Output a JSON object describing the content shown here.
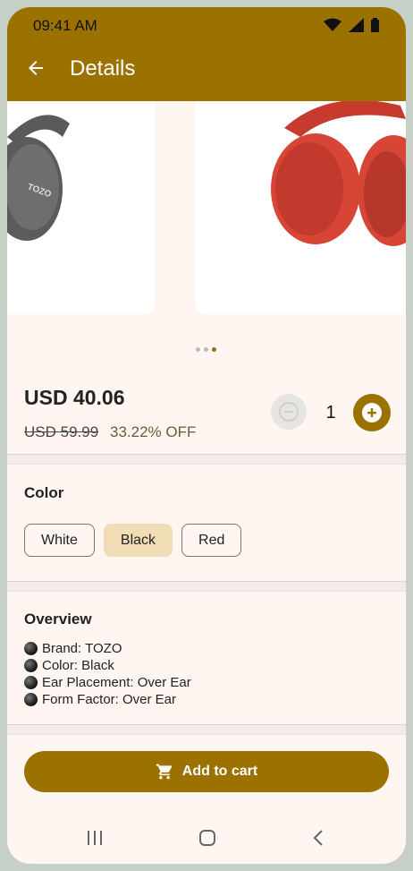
{
  "status": {
    "time": "09:41 AM"
  },
  "appbar": {
    "title": "Details"
  },
  "carousel": {
    "slide_count": 3,
    "active_index": 2
  },
  "product": {
    "price": "USD 40.06",
    "old_price": "USD 59.99",
    "discount": "33.22% OFF",
    "quantity": "1"
  },
  "color": {
    "heading": "Color",
    "options": [
      "White",
      "Black",
      "Red"
    ],
    "selected": "Black"
  },
  "overview": {
    "heading": "Overview",
    "items": [
      "Brand: TOZO",
      "Color: Black",
      "Ear Placement: Over Ear",
      "Form Factor: Over Ear"
    ]
  },
  "cart": {
    "label": "Add to cart"
  },
  "theme": {
    "accent": "#9b7200",
    "selected_chip": "#f1ddb5",
    "background": "#fff6f1"
  },
  "icons": [
    "wifi-icon",
    "signal-icon",
    "battery-icon",
    "back-arrow-icon",
    "minus-icon",
    "plus-icon",
    "cart-icon",
    "recents-icon",
    "home-icon",
    "nav-back-icon"
  ]
}
